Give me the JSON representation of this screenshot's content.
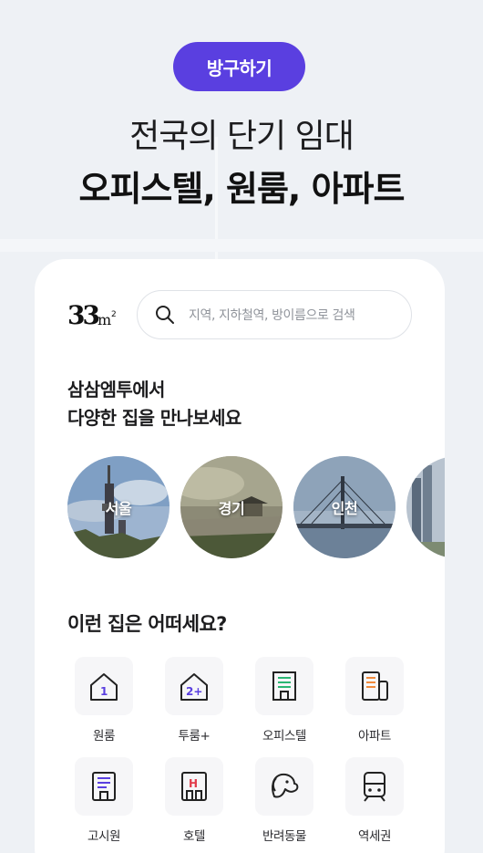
{
  "header": {
    "badge_label": "방구하기",
    "headline_line1": "전국의 단기 임대",
    "headline_line2": "오피스텔, 원룸, 아파트"
  },
  "app": {
    "logo_text": "33m²",
    "search": {
      "placeholder": "지역, 지하철역, 방이름으로 검색"
    }
  },
  "regions": {
    "title_line1": "삼삼엠투에서",
    "title_line2": "다양한 집을 만나보세요",
    "items": [
      {
        "label": "서울"
      },
      {
        "label": "경기"
      },
      {
        "label": "인천"
      },
      {
        "label": ""
      }
    ]
  },
  "categories": {
    "title": "이런 집은 어떠세요?",
    "items": [
      {
        "label": "원룸",
        "icon": "house-1-icon"
      },
      {
        "label": "투룸+",
        "icon": "house-2plus-icon"
      },
      {
        "label": "오피스텔",
        "icon": "office-building-icon"
      },
      {
        "label": "아파트",
        "icon": "apartment-icon"
      },
      {
        "label": "고시원",
        "icon": "gosiwon-building-icon"
      },
      {
        "label": "호텔",
        "icon": "hotel-icon"
      },
      {
        "label": "반려동물",
        "icon": "dog-icon"
      },
      {
        "label": "역세권",
        "icon": "train-icon"
      }
    ]
  },
  "colors": {
    "accent": "#5a3fe0",
    "icon_stroke": "#222222",
    "background": "#eef1f5"
  }
}
